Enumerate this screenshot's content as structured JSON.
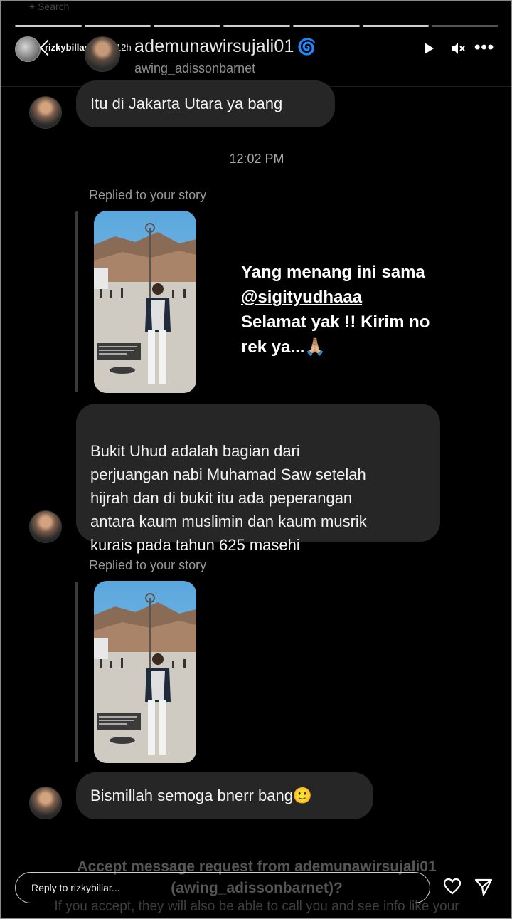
{
  "top_hint": "+ Search",
  "story": {
    "username": "rizkybillar",
    "time": "12h"
  },
  "chat": {
    "username": "ademunawirsujali01",
    "subname": "awing_adissonbarnet"
  },
  "icons": {
    "play": "play-icon",
    "mute": "speaker-muted-icon",
    "more": "more-dots-icon"
  },
  "messages": [
    {
      "text": "Itu di Jakarta Utara ya bang"
    },
    {
      "text": "Bukit Uhud adalah bagian dari\nperjuangan nabi Muhamad Saw setelah\nhijrah dan di bukit itu ada peperangan\nantara kaum muslimin dan kaum musrik\nkurais pada tahun 625 masehi"
    },
    {
      "text": "Bismillah semoga bnerr bang🙂"
    }
  ],
  "timestamp": "12:02 PM",
  "replied_label": "Replied to your story",
  "story_caption": {
    "line1": "Yang menang ini sama",
    "mention": "@sigityudhaaa",
    "line3": "Selamat yak !! Kirim no",
    "line4": "rek ya...🙏🏼"
  },
  "footer": {
    "accept_line1": "Accept message request from ademunawirsujali01",
    "accept_line2": "(awing_adissonbarnet)?",
    "accept_sub": "If you accept, they will also be able to call you and see info like your",
    "reply_placeholder": "Reply to rizkybillar..."
  },
  "colors": {
    "background": "#000000",
    "bubble": "#262626",
    "verified": "#3897f0"
  }
}
